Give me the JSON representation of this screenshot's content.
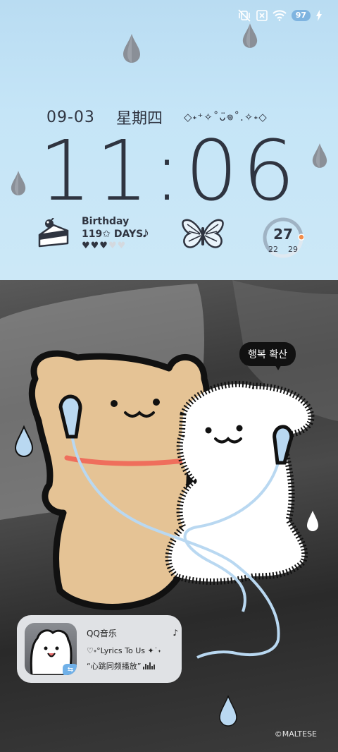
{
  "status_bar": {
    "icons": [
      "vibrate-off-icon",
      "sim-off-icon",
      "wifi-icon",
      "battery-icon",
      "charging-bolt-icon"
    ],
    "battery_level": "97"
  },
  "lockscreen": {
    "date": "09-03",
    "weekday": "星期四",
    "decoration": "◇˖⁺✧˚ᴗ̈𖦹˚.✧˖◇",
    "time": "11:06"
  },
  "birthday_widget": {
    "title": "Birthday",
    "days": "119✩ DAYS𝅘𝅥𝅮",
    "hearts_full": "♥♥♥",
    "hearts_empty": "♥♥"
  },
  "weather_widget": {
    "temperature": "27",
    "low": "22",
    "high": "29",
    "progress": 0.62,
    "accent_color": "#f28c4a"
  },
  "wallpaper": {
    "speech_bubble": "행복 확산",
    "watermark": "©MALTESE"
  },
  "music_widget": {
    "app_name": "QQ音乐",
    "note_icon": "♪",
    "track": "♡˖°Lyrics To Us ✦˙˖",
    "lyric": "“心跳同频播放”"
  },
  "colors": {
    "panel_bg": "#c5e5f7",
    "text_dark": "#2f3440",
    "raindrop": "#8a8f97",
    "earphone": "#b9d8f1"
  }
}
